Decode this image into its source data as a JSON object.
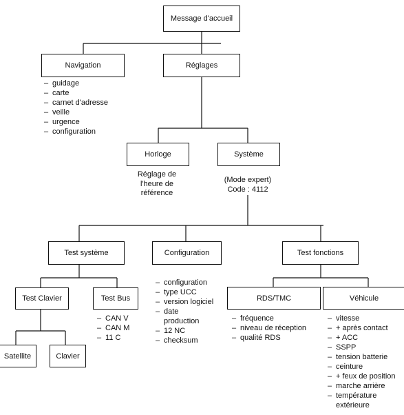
{
  "nodes": {
    "message": "Message d'accueil",
    "navigation": "Navigation",
    "reglages": "Réglages",
    "horloge": "Horloge",
    "systeme": "Système",
    "test_systeme": "Test système",
    "configuration": "Configuration",
    "test_fonctions": "Test fonctions",
    "test_clavier": "Test Clavier",
    "test_bus": "Test Bus",
    "satellite": "Satellite",
    "clavier": "Clavier",
    "rds_tmc": "RDS/TMC",
    "vehicule": "Véhicule"
  },
  "notes": {
    "horloge": [
      "Réglage de",
      "l'heure de",
      "référence"
    ],
    "systeme": [
      "(Mode expert)",
      "Code : 4112"
    ]
  },
  "lists": {
    "navigation": [
      "guidage",
      "carte",
      "carnet d'adresse",
      "veille",
      "urgence",
      "configuration"
    ],
    "configuration": [
      "configuration",
      "type UCC",
      "version logiciel",
      "date production",
      "12 NC",
      "checksum"
    ],
    "test_bus": [
      "CAN V",
      "CAN M",
      "11 C"
    ],
    "rds_tmc": [
      "fréquence",
      "niveau de réception",
      "qualité RDS"
    ],
    "vehicule": [
      "vitesse",
      "+ après contact",
      "+ ACC",
      "SSPP",
      "tension batterie",
      "ceinture",
      "+ feux de position",
      "marche arrière",
      "température extérieure"
    ]
  }
}
